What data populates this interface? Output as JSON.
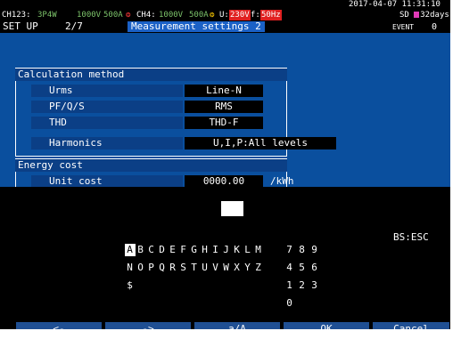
{
  "status": {
    "datetime": "2017-04-07 11:31:10",
    "line1_prefix": "CH123:",
    "wiring": "3P4W",
    "voltage1": "1000V",
    "current1": "500A",
    "ch4_prefix": "CH4:",
    "voltage2": "1000V",
    "current2": "500A",
    "u_prefix": "U:",
    "u_value": "230V",
    "f_prefix": "f:",
    "f_value": "50Hz",
    "sd_label": "SD",
    "sd_days": "32days",
    "event_label": "EVENT",
    "event_value": "0"
  },
  "header": {
    "mode": "SET UP",
    "page": "2/7",
    "title": "Measurement settings 2"
  },
  "sections": {
    "calc": {
      "heading": "Calculation method",
      "rows": [
        {
          "label": "Urms",
          "value": "Line-N"
        },
        {
          "label": "PF/Q/S",
          "value": "RMS"
        },
        {
          "label": "THD",
          "value": "THD-F"
        },
        {
          "label": "Harmonics",
          "value": "U,I,P:All levels"
        }
      ]
    },
    "energy": {
      "heading": "Energy cost",
      "row_label": "Unit cost",
      "row_value": "0000.00",
      "row_unit": "/kWh"
    }
  },
  "keyboard": {
    "row1": [
      "A",
      "B",
      "C",
      "D",
      "E",
      "F",
      "G",
      "H",
      "I",
      "J",
      "K",
      "L",
      "M"
    ],
    "row2": [
      "N",
      "O",
      "P",
      "Q",
      "R",
      "S",
      "T",
      "U",
      "V",
      "W",
      "X",
      "Y",
      "Z"
    ],
    "row3": [
      "$"
    ],
    "numrow1": [
      "7",
      "8",
      "9"
    ],
    "numrow2": [
      "4",
      "5",
      "6"
    ],
    "numrow3": [
      "1",
      "2",
      "3"
    ],
    "numrow4": [
      "0"
    ],
    "bs_esc": "BS:ESC",
    "selected_key": "A"
  },
  "function_keys": {
    "left": "<-",
    "right": "->",
    "case": "a/A",
    "ok": "OK",
    "cancel": "Cancel"
  },
  "colors": {
    "background_blue": "#0a4f9e",
    "panel_blue": "#0b3f86",
    "fkey_blue": "#1f4f93",
    "accent_red": "#e02020",
    "sd_magenta": "#e03ab7"
  },
  "icons": {
    "battery": "battery-icon",
    "save": "save-icon",
    "current_clamp": "clamp-icon"
  }
}
